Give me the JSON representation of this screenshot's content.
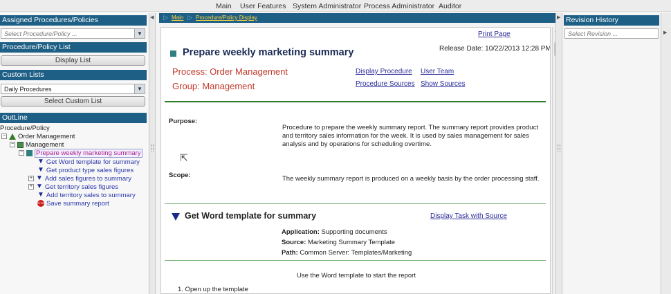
{
  "top_menu": [
    "Main",
    "User Features",
    "System Administrator",
    "Process Administrator",
    "Auditor"
  ],
  "left": {
    "assigned_header": "Assigned Procedures/Policies",
    "assigned_placeholder": "Select Procedure/Policy ...",
    "list_header": "Procedure/Policy List",
    "display_list_button": "Display List",
    "custom_header": "Custom Lists",
    "custom_value": "Daily Procedures",
    "select_custom_button": "Select Custom List",
    "outline_header": "OutLine",
    "tree": {
      "root": "Procedure/Policy",
      "n1": "Order Management",
      "n2": "Management",
      "n3": "Prepare weekly marketing summary",
      "t1": "Get Word template for summary",
      "t2": "Get product type sales figures",
      "t3": "Add sales figures to summary",
      "t4": "Get territory sales figures",
      "t5": "Add territory sales to summary",
      "t6": "Save summary report",
      "stop_icon_text": "STOP"
    }
  },
  "breadcrumb": [
    "Main",
    "Procedure/Policy Display"
  ],
  "doc": {
    "print_page": "Print Page",
    "title": "Prepare weekly marketing summary",
    "release_date": "Release Date: 10/22/2013 12:28 PM",
    "process": "Process: Order Management",
    "group": "Group: Management",
    "display_procedure": "Display Procedure",
    "user_team": "User Team",
    "procedure_sources": "Procedure Sources",
    "show_sources": "Show Sources",
    "purpose_label": "Purpose:",
    "purpose_text": "Procedure to prepare the weekly summary report. The summary report provides product and territory sales information for the week. It is used by sales management for sales analysis and by operations for scheduling overtime.",
    "scope_label": "Scope:",
    "scope_text": "The weekly summary report is produced on a weekly basis by the order processing staff.",
    "task_title": "Get Word template for summary",
    "display_task": "Display Task with Source",
    "application_label": "Application:",
    "application_value": "Supporting documents",
    "source_label": "Source:",
    "source_value": "Marketing Summary Template",
    "path_label": "Path:",
    "path_value": "Common Server: Templates/Marketing",
    "instruction": "Use the Word template to start the report",
    "step1": "1.  Open up the template"
  },
  "right": {
    "header": "Revision History",
    "placeholder": "Select Revision ..."
  },
  "colors": {
    "header_blue": "#1e5f86",
    "breadcrumb_link": "#ffd23a",
    "title_navy": "#1a2b55",
    "process_red": "#c0392b",
    "divider_green": "#2f7f2f"
  }
}
